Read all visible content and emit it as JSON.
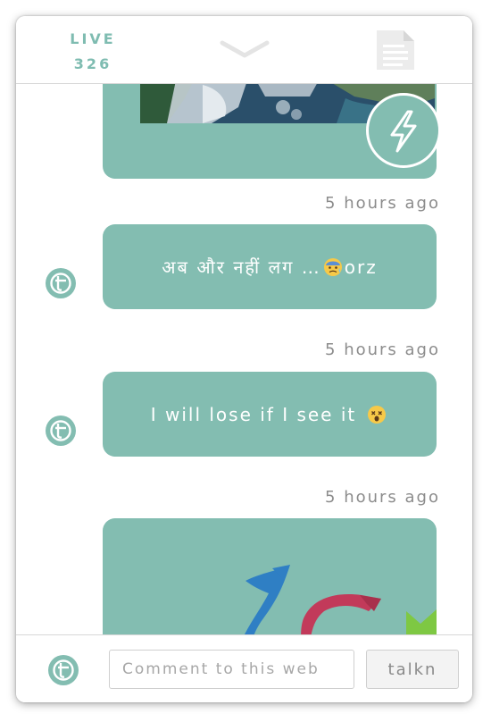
{
  "header": {
    "live_label": "LIVE",
    "live_count": "326"
  },
  "posts": [
    {
      "timestamp": "5 hours ago",
      "text": "अब और नहीं लग …",
      "emoji": "anxious-face",
      "suffix": "orz"
    },
    {
      "timestamp": "5 hours ago",
      "text": "I will lose if I see it",
      "emoji": "dizzy-face"
    },
    {
      "timestamp": "5 hours ago"
    }
  ],
  "footer": {
    "comment_placeholder": "Comment to this web",
    "submit_label": "talkn"
  },
  "colors": {
    "accent": "#83bdb1",
    "live_text": "#7fbcb1",
    "timestamp": "#8c8c8c"
  },
  "icons": [
    "chevron-down-icon",
    "document-icon",
    "lightning-bolt-icon",
    "talkn-avatar-icon",
    "anxious-face-emoji",
    "dizzy-face-emoji"
  ]
}
